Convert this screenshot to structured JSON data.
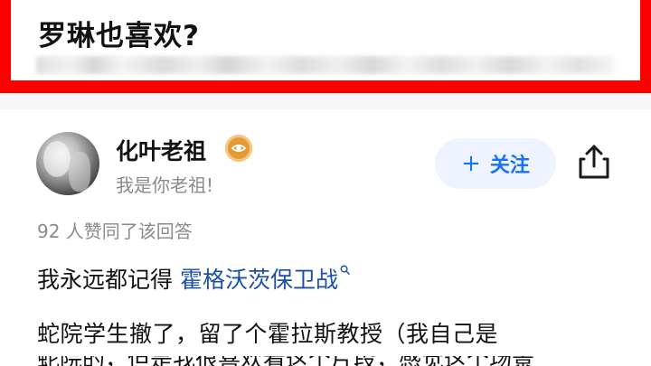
{
  "question": {
    "title": "罗琳也喜欢?"
  },
  "author": {
    "name": "化叶老祖",
    "bio": "我是你老祖!"
  },
  "follow": {
    "plus": "+",
    "label": "关注"
  },
  "votes": {
    "text": "92 人赞同了该回答"
  },
  "answer": {
    "line1_prefix": "我永远都记得 ",
    "line1_link": "霍格沃茨保卫战",
    "line2": "蛇院学生撤了，留了个霍拉斯教授（我自己是",
    "line3_partial": "蛇院的，但是我很喜欢看这个片段，感觉这个场景"
  },
  "icons": {
    "verified_badge": "eye-badge-icon",
    "share": "share-icon",
    "link_search": "search-icon"
  },
  "colors": {
    "highlight_border": "#ff0000",
    "link": "#1c4fa8",
    "follow_text": "#1772f6",
    "badge": "#e39a35"
  }
}
